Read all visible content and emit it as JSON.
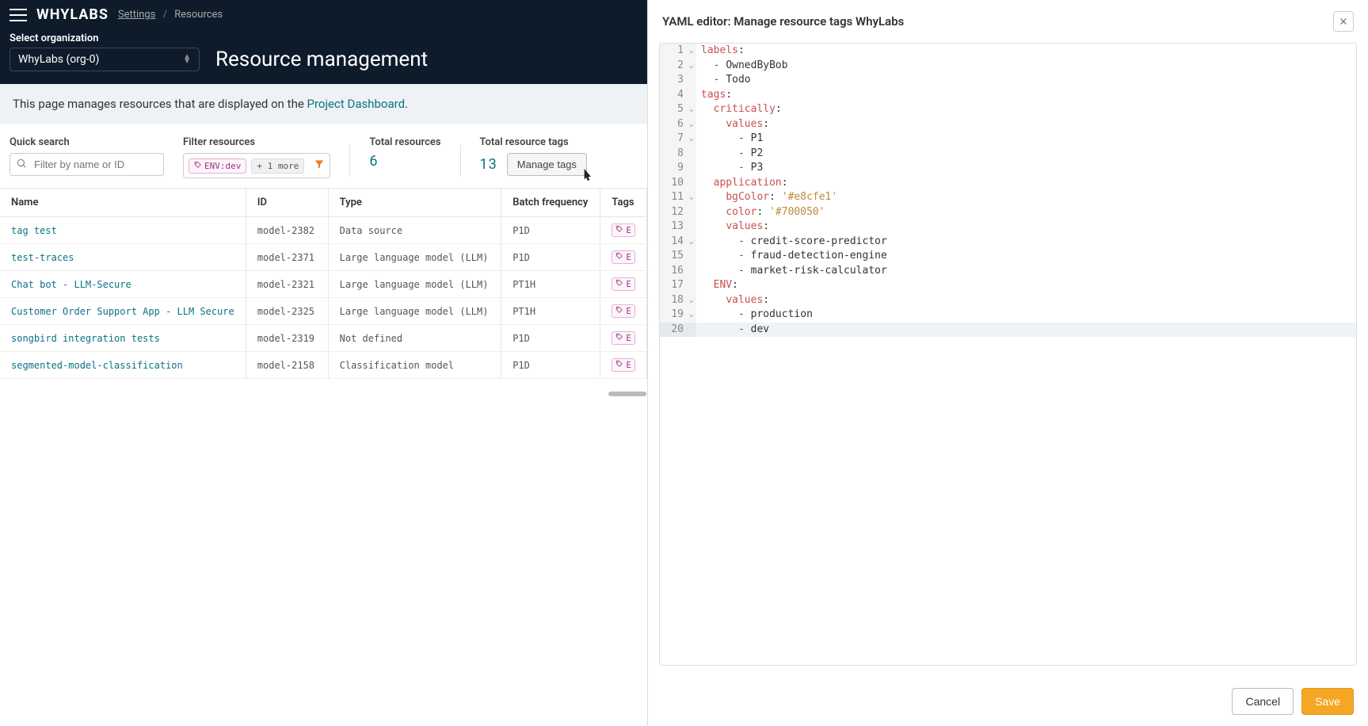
{
  "header": {
    "logo": "WHYLABS",
    "breadcrumb": {
      "settings": "Settings",
      "resources": "Resources"
    },
    "org_label": "Select organization",
    "org_value": "WhyLabs (org-0)",
    "page_title": "Resource management"
  },
  "banner": {
    "prefix": "This page manages resources that are displayed on the ",
    "link": "Project Dashboard",
    "suffix": "."
  },
  "controls": {
    "search_label": "Quick search",
    "search_placeholder": "Filter by name or ID",
    "filter_label": "Filter resources",
    "filter_chip": "ENV:dev",
    "filter_more": "+ 1 more",
    "total_resources_label": "Total resources",
    "total_resources_value": "6",
    "total_tags_label": "Total resource tags",
    "total_tags_value": "13",
    "manage_tags": "Manage tags"
  },
  "table": {
    "headers": {
      "name": "Name",
      "id": "ID",
      "type": "Type",
      "batch": "Batch frequency",
      "tags": "Tags"
    },
    "rows": [
      {
        "name": "tag test",
        "id": "model-2382",
        "type": "Data source",
        "batch": "P1D",
        "tag": "E"
      },
      {
        "name": "test-traces",
        "id": "model-2371",
        "type": "Large language model (LLM)",
        "batch": "P1D",
        "tag": "E"
      },
      {
        "name": "Chat bot - LLM-Secure",
        "id": "model-2321",
        "type": "Large language model (LLM)",
        "batch": "PT1H",
        "tag": "E"
      },
      {
        "name": "Customer Order Support App - LLM Secure",
        "id": "model-2325",
        "type": "Large language model (LLM)",
        "batch": "PT1H",
        "tag": "E"
      },
      {
        "name": "songbird integration tests",
        "id": "model-2319",
        "type": "Not defined",
        "batch": "P1D",
        "tag": "E"
      },
      {
        "name": "segmented-model-classification",
        "id": "model-2158",
        "type": "Classification model",
        "batch": "P1D",
        "tag": "E"
      }
    ]
  },
  "editor": {
    "title": "YAML editor: Manage resource tags WhyLabs",
    "cancel": "Cancel",
    "save": "Save",
    "lines": [
      {
        "n": 1,
        "fold": true,
        "hl": false,
        "tokens": [
          [
            "key",
            "labels"
          ],
          [
            "p",
            ":"
          ]
        ]
      },
      {
        "n": 2,
        "fold": true,
        "hl": false,
        "tokens": [
          [
            "sp",
            "  "
          ],
          [
            "dash",
            "- "
          ],
          [
            "val",
            "OwnedByBob"
          ]
        ]
      },
      {
        "n": 3,
        "fold": false,
        "hl": false,
        "tokens": [
          [
            "sp",
            "  "
          ],
          [
            "dash",
            "- "
          ],
          [
            "val",
            "Todo"
          ]
        ]
      },
      {
        "n": 4,
        "fold": false,
        "hl": false,
        "tokens": [
          [
            "key",
            "tags"
          ],
          [
            "p",
            ":"
          ]
        ]
      },
      {
        "n": 5,
        "fold": true,
        "hl": false,
        "tokens": [
          [
            "sp",
            "  "
          ],
          [
            "key",
            "critically"
          ],
          [
            "p",
            ":"
          ]
        ]
      },
      {
        "n": 6,
        "fold": true,
        "hl": false,
        "tokens": [
          [
            "sp",
            "    "
          ],
          [
            "key",
            "values"
          ],
          [
            "p",
            ":"
          ]
        ]
      },
      {
        "n": 7,
        "fold": true,
        "hl": false,
        "tokens": [
          [
            "sp",
            "      "
          ],
          [
            "dash",
            "- "
          ],
          [
            "val",
            "P1"
          ]
        ]
      },
      {
        "n": 8,
        "fold": false,
        "hl": false,
        "tokens": [
          [
            "sp",
            "      "
          ],
          [
            "dash",
            "- "
          ],
          [
            "val",
            "P2"
          ]
        ]
      },
      {
        "n": 9,
        "fold": false,
        "hl": false,
        "tokens": [
          [
            "sp",
            "      "
          ],
          [
            "dash",
            "- "
          ],
          [
            "val",
            "P3"
          ]
        ]
      },
      {
        "n": 10,
        "fold": false,
        "hl": false,
        "tokens": [
          [
            "sp",
            "  "
          ],
          [
            "key",
            "application"
          ],
          [
            "p",
            ":"
          ]
        ]
      },
      {
        "n": 11,
        "fold": true,
        "hl": false,
        "tokens": [
          [
            "sp",
            "    "
          ],
          [
            "key",
            "bgColor"
          ],
          [
            "p",
            ": "
          ],
          [
            "str",
            "'#e8cfe1'"
          ]
        ]
      },
      {
        "n": 12,
        "fold": false,
        "hl": false,
        "tokens": [
          [
            "sp",
            "    "
          ],
          [
            "key",
            "color"
          ],
          [
            "p",
            ": "
          ],
          [
            "str",
            "'#700050'"
          ]
        ]
      },
      {
        "n": 13,
        "fold": false,
        "hl": false,
        "tokens": [
          [
            "sp",
            "    "
          ],
          [
            "key",
            "values"
          ],
          [
            "p",
            ":"
          ]
        ]
      },
      {
        "n": 14,
        "fold": true,
        "hl": false,
        "tokens": [
          [
            "sp",
            "      "
          ],
          [
            "dash",
            "- "
          ],
          [
            "val",
            "credit-score-predictor"
          ]
        ]
      },
      {
        "n": 15,
        "fold": false,
        "hl": false,
        "tokens": [
          [
            "sp",
            "      "
          ],
          [
            "dash",
            "- "
          ],
          [
            "val",
            "fraud-detection-engine"
          ]
        ]
      },
      {
        "n": 16,
        "fold": false,
        "hl": false,
        "tokens": [
          [
            "sp",
            "      "
          ],
          [
            "dash",
            "- "
          ],
          [
            "val",
            "market-risk-calculator"
          ]
        ]
      },
      {
        "n": 17,
        "fold": false,
        "hl": false,
        "tokens": [
          [
            "sp",
            "  "
          ],
          [
            "key",
            "ENV"
          ],
          [
            "p",
            ":"
          ]
        ]
      },
      {
        "n": 18,
        "fold": true,
        "hl": false,
        "tokens": [
          [
            "sp",
            "    "
          ],
          [
            "key",
            "values"
          ],
          [
            "p",
            ":"
          ]
        ]
      },
      {
        "n": 19,
        "fold": true,
        "hl": false,
        "tokens": [
          [
            "sp",
            "      "
          ],
          [
            "dash",
            "- "
          ],
          [
            "val",
            "production"
          ]
        ]
      },
      {
        "n": 20,
        "fold": false,
        "hl": true,
        "tokens": [
          [
            "sp",
            "      "
          ],
          [
            "dash",
            "- "
          ],
          [
            "val",
            "dev"
          ]
        ]
      }
    ]
  }
}
